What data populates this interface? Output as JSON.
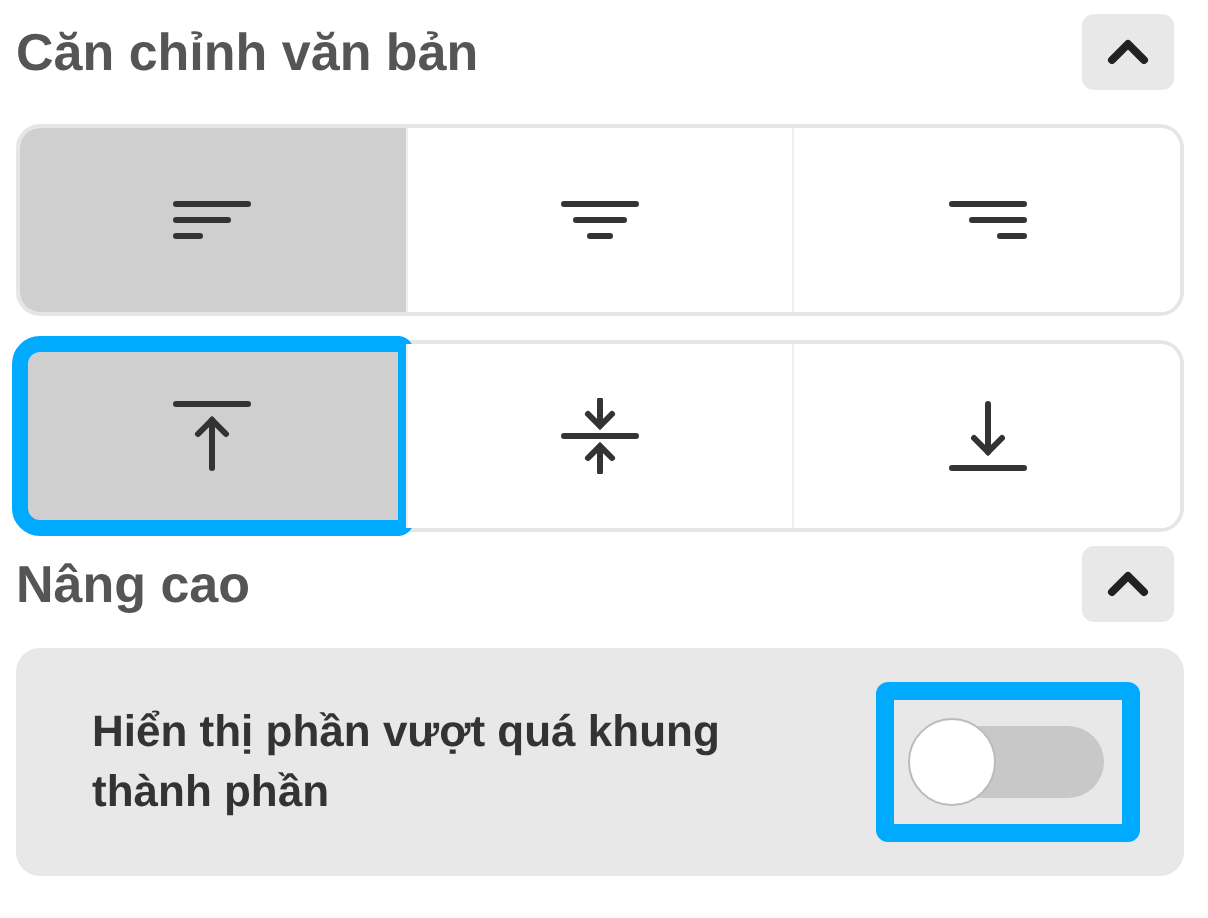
{
  "sections": [
    {
      "title": "Căn chỉnh văn bản",
      "expanded": true,
      "groups": [
        {
          "buttons": [
            {
              "kind": "align-left",
              "selected": true,
              "highlighted": false
            },
            {
              "kind": "align-center",
              "selected": false,
              "highlighted": false
            },
            {
              "kind": "align-right",
              "selected": false,
              "highlighted": false
            }
          ]
        },
        {
          "buttons": [
            {
              "kind": "align-top",
              "selected": true,
              "highlighted": true
            },
            {
              "kind": "align-middle",
              "selected": false,
              "highlighted": false
            },
            {
              "kind": "align-bottom",
              "selected": false,
              "highlighted": false
            }
          ]
        }
      ]
    },
    {
      "title": "Nâng cao",
      "expanded": true,
      "setting": {
        "label": "Hiển thị phần vượt quá khung thành phần",
        "on": false,
        "highlighted": true
      }
    }
  ]
}
